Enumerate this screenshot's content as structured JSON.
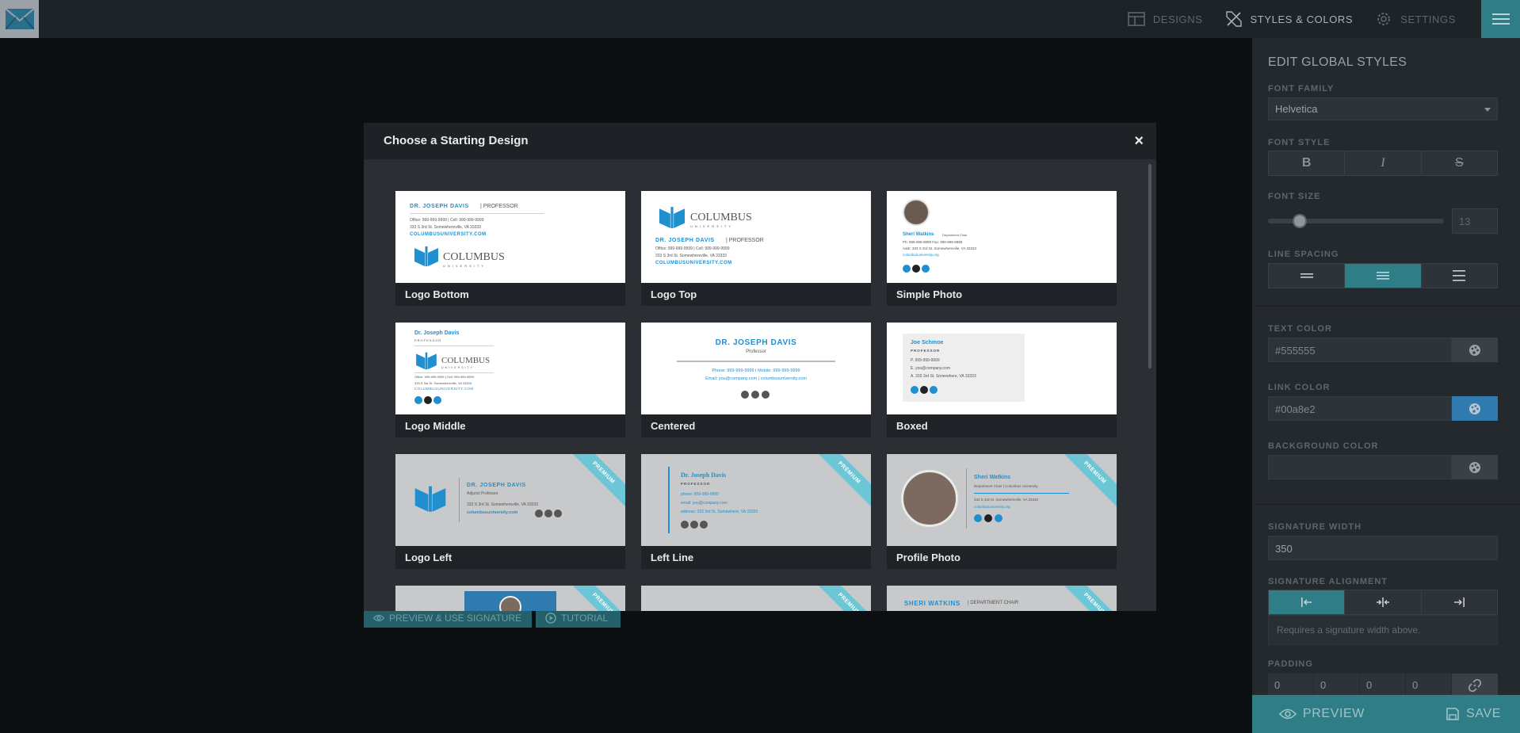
{
  "nav": {
    "designs": "DESIGNS",
    "styles": "STYLES & COLORS",
    "settings": "SETTINGS"
  },
  "panel": {
    "title": "EDIT GLOBAL STYLES",
    "font_family_label": "FONT FAMILY",
    "font_family_value": "Helvetica",
    "font_style_label": "FONT STYLE",
    "font_style_bold": "B",
    "font_style_italic": "I",
    "font_style_strike": "S",
    "font_size_label": "FONT SIZE",
    "font_size_value": "13",
    "font_size_fraction": 0.18,
    "line_spacing_label": "LINE SPACING",
    "text_color_label": "TEXT COLOR",
    "text_color_value": "#555555",
    "link_color_label": "LINK COLOR",
    "link_color_value": "#00a8e2",
    "background_color_label": "BACKGROUND COLOR",
    "signature_width_label": "SIGNATURE WIDTH",
    "signature_width_value": "350",
    "signature_alignment_label": "SIGNATURE ALIGNMENT",
    "alignment_hint": "Requires a signature width above.",
    "padding_label": "PADDING",
    "padding_values": [
      "0",
      "0",
      "0",
      "0"
    ],
    "preview_button": "PREVIEW",
    "save_button": "SAVE"
  },
  "under_buttons": {
    "preview_use": "PREVIEW & USE SIGNATURE",
    "tutorial": "TUTORIAL"
  },
  "modal": {
    "title": "Choose a Starting Design",
    "close": "×",
    "premium_label": "PREMIUM",
    "designs": [
      {
        "label": "Logo Bottom",
        "premium": false
      },
      {
        "label": "Logo Top",
        "premium": false
      },
      {
        "label": "Simple Photo",
        "premium": false
      },
      {
        "label": "Logo Middle",
        "premium": false
      },
      {
        "label": "Centered",
        "premium": false
      },
      {
        "label": "Boxed",
        "premium": false
      },
      {
        "label": "Logo Left",
        "premium": true
      },
      {
        "label": "Left Line",
        "premium": true
      },
      {
        "label": "Profile Photo",
        "premium": true
      }
    ]
  },
  "thumbs": {
    "name_upper": "DR. JOSEPH DAVIS",
    "title_upper": "| PROFESSOR",
    "office_line": "Office: 999-999-9999 | Cell: 999-999-9999",
    "address": "333 S 3rd St. Somewhereville, VA 33333",
    "website_upper": "COLUMBUSUNIVERSITY.COM",
    "logo_word": "COLUMBUS",
    "logo_sub": "UNIVERSITY",
    "sheri_name": "Sheri Watkins",
    "sheri_title": "Department Chair",
    "sheri_phone": "Ph: 999-999-9999  Fax: 999-999-9999",
    "sheri_addr": "Addr: 333 S 3rd St. Somewhereville, VA 33333",
    "sheri_site": "columbusuniversity.org",
    "name_title": "Dr. Joseph Davis",
    "professor_upper": "PROFESSOR",
    "centered_title": "Professor",
    "centered_phone": "Phone: 999-999-9999 | Mobile: 999-999-9999",
    "centered_email": "Email: you@company.com | columbusuniversity.com",
    "joe_name": "Joe Schmoe",
    "joe_p": "P. 999-999-9999",
    "joe_e": "E. you@company.com",
    "joe_a": "A. 333 3rd St. Somewhere, VA 33333",
    "adjunct": "Adjunct Professor",
    "ll_phone": "phone: 999-999-9999",
    "ll_email": "email: you@company.com",
    "ll_address": "address: 333 3rd St. Somewhere, VA 33333",
    "pp_title": "Department Chair | Columbus University",
    "sheri_upper": "SHERI WATKINS",
    "dept_chair_upper": "| DEPARTMENT CHAIR"
  }
}
